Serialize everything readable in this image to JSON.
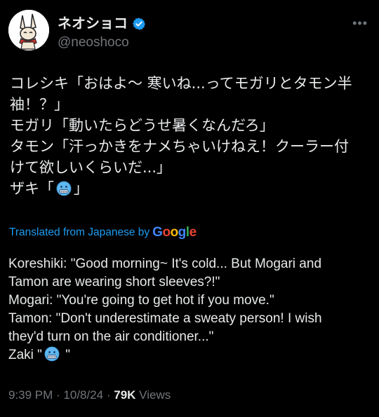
{
  "tweet": {
    "display_name": "ネオショコ",
    "handle": "@neoshoco",
    "more_icon": "ellipsis-icon",
    "verified_icon": "verified-badge-icon",
    "original_lines": [
      "コレシキ「おはよ〜 寒いね...ってモガリとタモン半",
      "袖！？」",
      "モガリ「動いたらどうせ暑くなんだろ」",
      "タモン「汗っかきをナメちゃいけねえ！クーラー付",
      "けて欲しいくらいだ...」"
    ],
    "original_zaki_prefix": "ザキ「",
    "original_zaki_suffix": "」",
    "translated_label": "Translated from Japanese by",
    "translated_provider": "Google",
    "translation_lines": [
      "Koreshiki: \"Good morning~ It's cold... But Mogari and",
      "Tamon are wearing short sleeves?!\"",
      "Mogari: \"You're going to get hot if you move.\"",
      "Tamon: \"Don't underestimate a sweaty person! I wish",
      "they'd turn on the air conditioner...\""
    ],
    "translation_zaki_prefix": "Zaki \"",
    "translation_zaki_suffix": " \"",
    "emoji_icon": "cold-face-emoji-icon",
    "time": "9:39 PM",
    "separator_1": " · ",
    "date": "10/8/24",
    "separator_2": " · ",
    "views_count": "79K",
    "views_label": " Views"
  },
  "colors": {
    "background": "#000000",
    "text": "#e7e9ea",
    "muted": "#71767b",
    "link": "#1d9bf0",
    "verified": "#1d9bf0"
  }
}
